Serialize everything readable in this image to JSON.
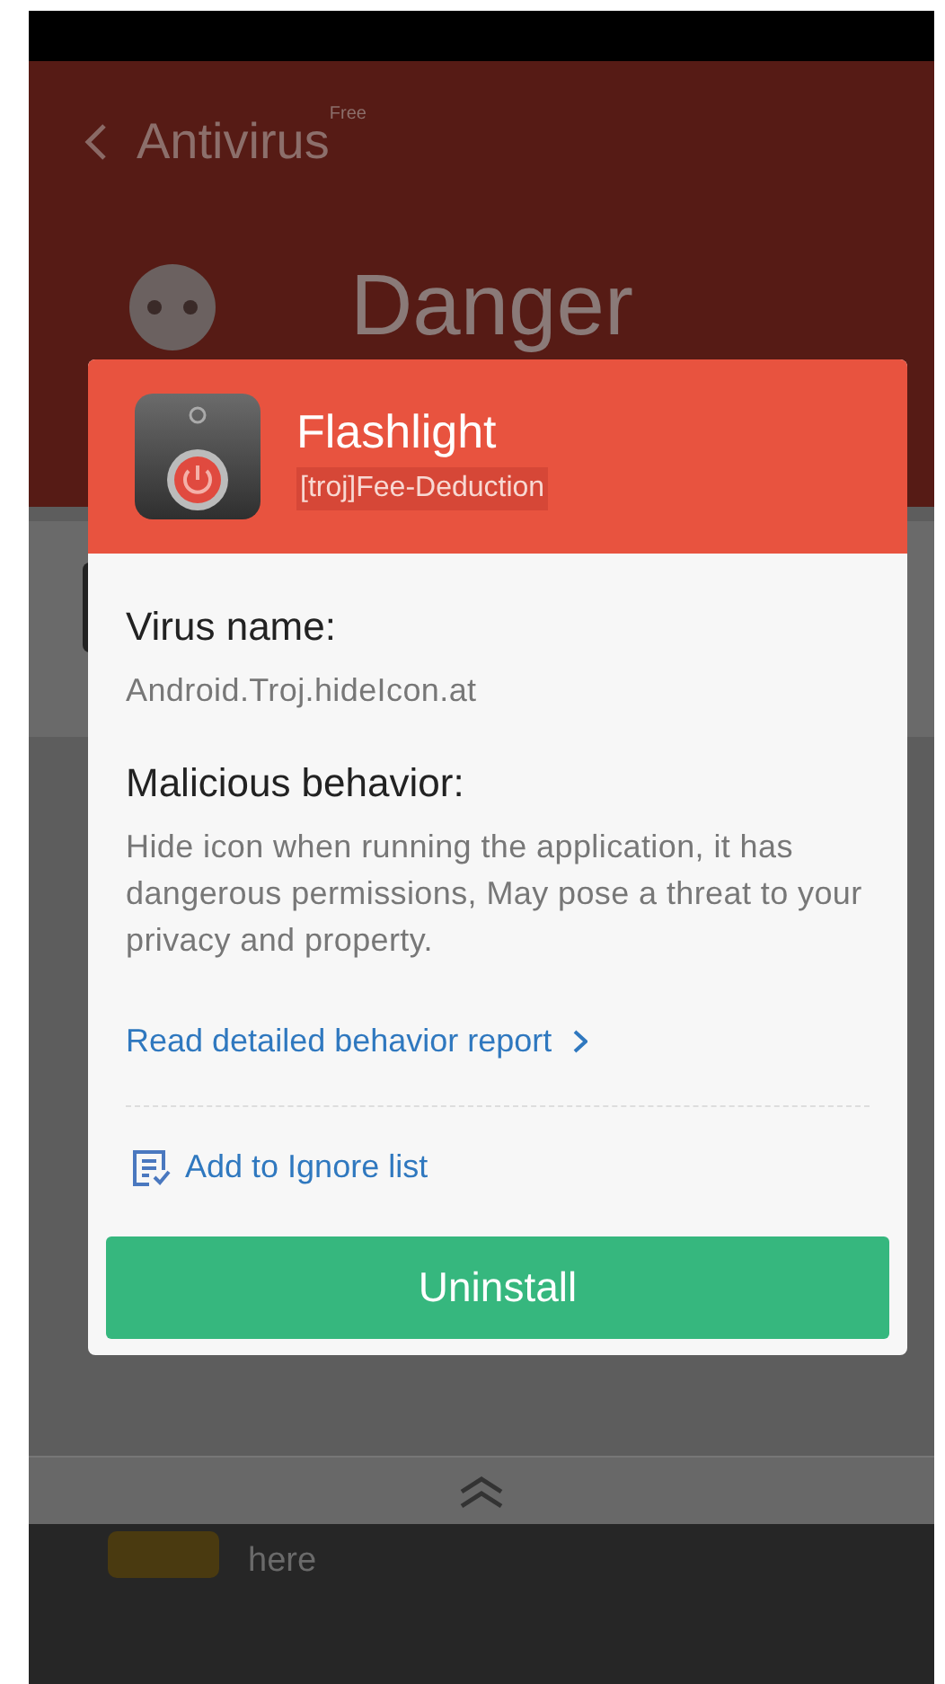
{
  "header": {
    "title": "Antivirus",
    "title_badge": "Free",
    "status": "Danger"
  },
  "dialog": {
    "app_name": "Flashlight",
    "app_tag": "[troj]Fee-Deduction",
    "sections": [
      {
        "heading": "Virus name:",
        "text": "Android.Troj.hideIcon.at"
      },
      {
        "heading": "Malicious behavior:",
        "text": "Hide icon when running the application, it has dangerous permissions, May pose a threat to your privacy and property."
      }
    ],
    "report_link": "Read detailed behavior report",
    "ignore_action": "Add to Ignore list",
    "uninstall_button": "Uninstall"
  },
  "background_list": [
    {
      "text": "here"
    }
  ]
}
